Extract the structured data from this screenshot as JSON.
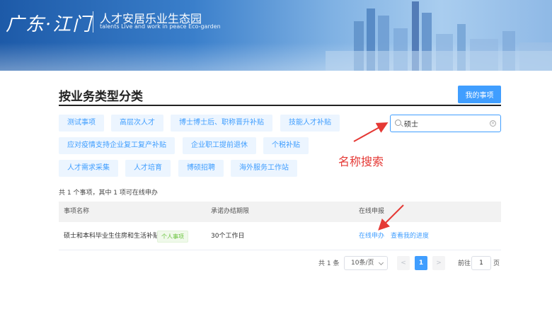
{
  "header": {
    "logo_text": "广东·江门",
    "site_title": "人才安居乐业生态园",
    "site_subtitle": "talents Live and work in peace Eco-garden"
  },
  "section": {
    "title": "按业务类型分类",
    "my_items_label": "我的事项"
  },
  "categories": [
    "测试事项",
    "高层次人才",
    "博士博士后、职称晋升补贴",
    "技能人才补贴",
    "应对疫情支持企业复工复产补贴",
    "企业职工提前退休",
    "个税补贴",
    "人才需求采集",
    "人才培育",
    "博硕招聘",
    "海外服务工作站"
  ],
  "search": {
    "value": "硕士"
  },
  "annotation": "名称搜索",
  "summary": "共 1 个事项，其中 1 项可在线申办",
  "table": {
    "headers": [
      "事项名称",
      "承诺办结期限",
      "在线申报"
    ],
    "rows": [
      {
        "name": "硕士和本科毕业生住房和生活补贴",
        "tag": "个人事项",
        "deadline": "30个工作日",
        "apply": "在线申办",
        "progress": "查看我的进度"
      }
    ]
  },
  "pagination": {
    "total": "共 1 条",
    "page_size": "10条/页",
    "prev": "<",
    "current": "1",
    "next": ">",
    "goto_label": "前往",
    "goto_value": "1",
    "page_suffix": "页"
  },
  "colors": {
    "primary": "#409eff",
    "annotation": "#e53935",
    "tag_green": "#67c23a"
  }
}
